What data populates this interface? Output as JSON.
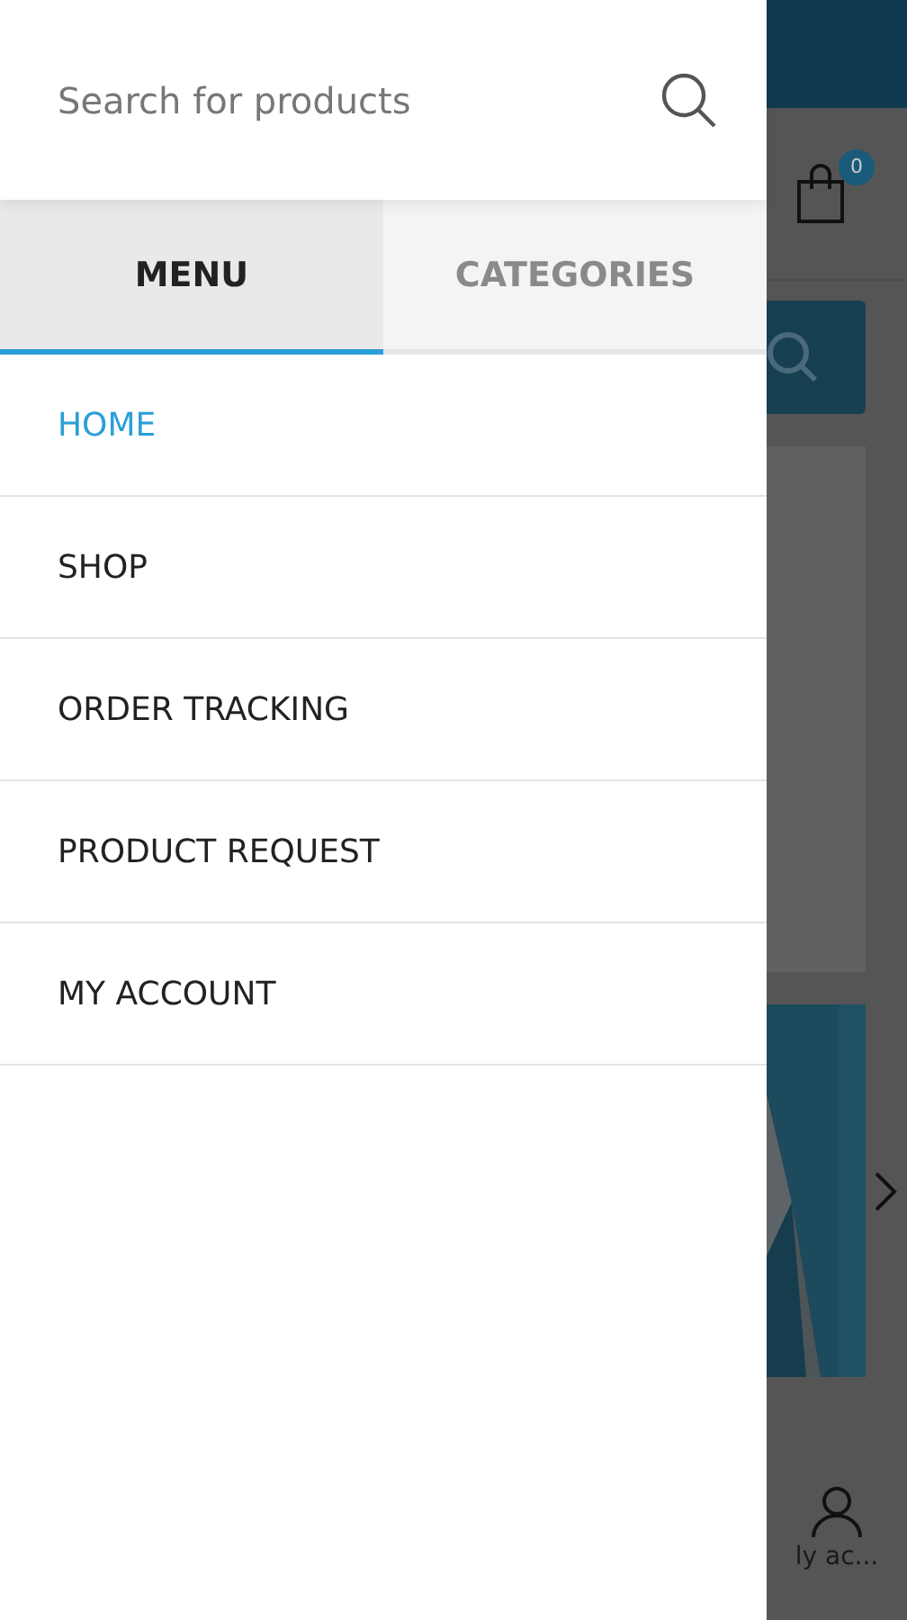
{
  "search": {
    "placeholder": "Search for products"
  },
  "tabs": [
    {
      "label": "MENU",
      "selected": true
    },
    {
      "label": "CATEGORIES",
      "selected": false
    }
  ],
  "menu_items": [
    {
      "label": "HOME",
      "selected": true
    },
    {
      "label": "SHOP",
      "selected": false
    },
    {
      "label": "ORDER TRACKING",
      "selected": false
    },
    {
      "label": "PRODUCT REQUEST",
      "selected": false
    },
    {
      "label": "MY ACCOUNT",
      "selected": false
    }
  ],
  "background_page": {
    "cart_count": "0",
    "account_label": "ly ac..."
  }
}
